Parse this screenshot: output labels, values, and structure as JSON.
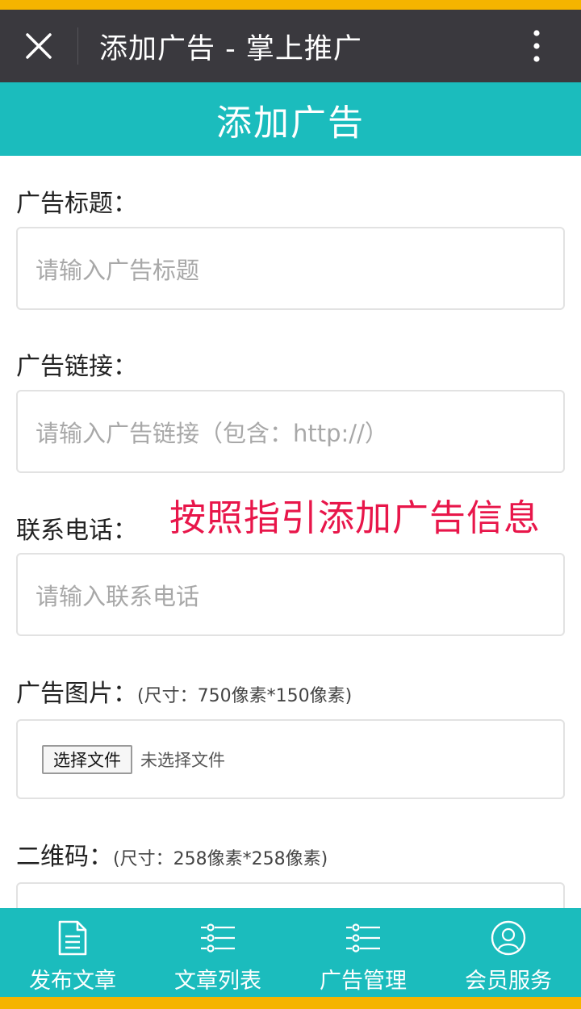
{
  "browser": {
    "title": "添加广告 - 掌上推广"
  },
  "header": {
    "title": "添加广告"
  },
  "form": {
    "ad_title": {
      "label": "广告标题：",
      "placeholder": "请输入广告标题"
    },
    "ad_link": {
      "label": "广告链接：",
      "placeholder": "请输入广告链接（包含：http://）"
    },
    "phone": {
      "label": "联系电话：",
      "placeholder": "请输入联系电话"
    },
    "ad_image": {
      "label": "广告图片：",
      "hint": "(尺寸：750像素*150像素)",
      "button": "选择文件",
      "status": "未选择文件"
    },
    "qrcode": {
      "label": "二维码：",
      "hint": "(尺寸：258像素*258像素)"
    }
  },
  "annotation": "按照指引添加广告信息",
  "tabs": [
    {
      "label": "发布文章",
      "icon": "document-icon"
    },
    {
      "label": "文章列表",
      "icon": "list-icon"
    },
    {
      "label": "广告管理",
      "icon": "list-icon"
    },
    {
      "label": "会员服务",
      "icon": "user-icon"
    }
  ],
  "colors": {
    "accent": "#1bbcbd",
    "status_strip": "#f5b400",
    "wx_bar": "#3a393e",
    "annotation": "#e8164a"
  }
}
